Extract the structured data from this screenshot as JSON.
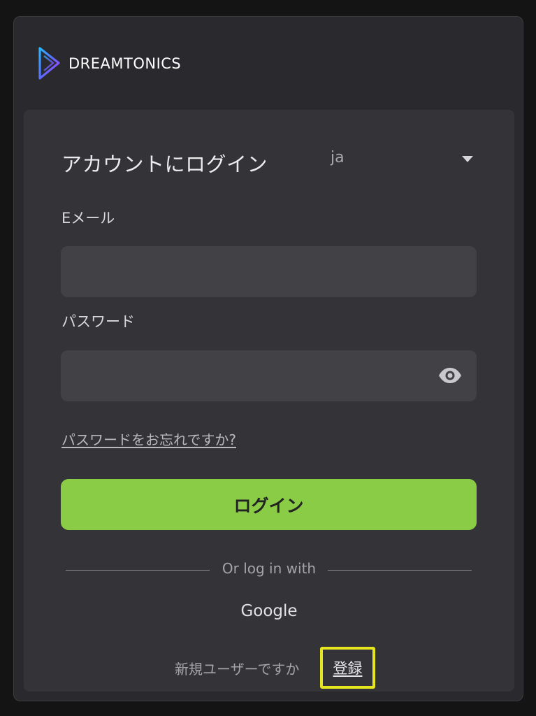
{
  "brand": {
    "name": "DREAMTONICS",
    "logo_icon": "dreamtonics-play-logo-icon"
  },
  "login": {
    "title": "アカウントにログイン",
    "language": {
      "selected": "ja",
      "icon": "caret-down-icon"
    },
    "email": {
      "label": "Eメール",
      "value": ""
    },
    "password": {
      "label": "パスワード",
      "value": "",
      "toggle_icon": "eye-icon"
    },
    "forgot_link": "パスワードをお忘れですか?",
    "submit_label": "ログイン",
    "divider_text": "Or log in with",
    "google_label": "Google",
    "new_user_text": "新規ユーザーですか",
    "register_label": "登録",
    "colors": {
      "accent": "#8bcc47",
      "highlight": "#e6e61e"
    }
  }
}
